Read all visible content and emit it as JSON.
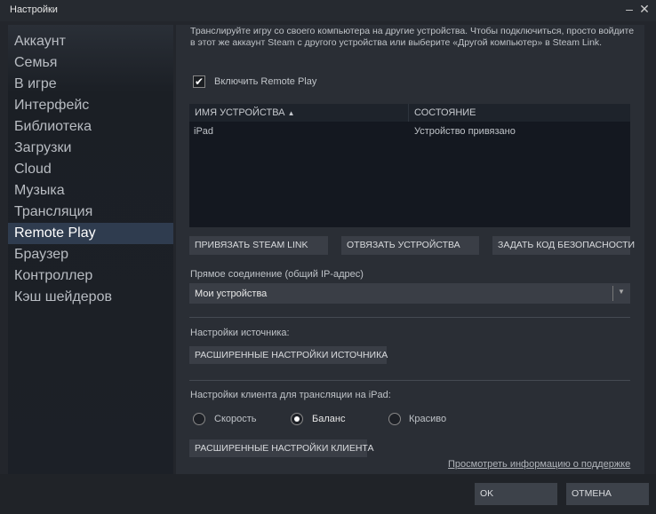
{
  "window": {
    "title": "Настройки"
  },
  "sidebar": {
    "items": [
      {
        "label": "Аккаунт"
      },
      {
        "label": "Семья"
      },
      {
        "label": "В игре"
      },
      {
        "label": "Интерфейс"
      },
      {
        "label": "Библиотека"
      },
      {
        "label": "Загрузки"
      },
      {
        "label": "Cloud"
      },
      {
        "label": "Музыка"
      },
      {
        "label": "Трансляция"
      },
      {
        "label": "Remote Play",
        "selected": true
      },
      {
        "label": "Браузер"
      },
      {
        "label": "Контроллер"
      },
      {
        "label": "Кэш шейдеров"
      }
    ]
  },
  "main": {
    "description": "Транслируйте игру со своего компьютера на другие устройства. Чтобы подключиться, просто войдите в этот же аккаунт Steam с другого устройства или выберите «Другой компьютер» в Steam Link.",
    "enable_label": "Включить Remote Play",
    "enable_checked": true,
    "table": {
      "columns": [
        "ИМЯ УСТРОЙСТВА",
        "СОСТОЯНИЕ"
      ],
      "rows": [
        [
          "iPad",
          "Устройство привязано"
        ]
      ]
    },
    "buttons": {
      "pair": "ПРИВЯЗАТЬ STEAM LINK",
      "unpair": "ОТВЯЗАТЬ УСТРОЙСТВА",
      "security": "ЗАДАТЬ КОД БЕЗОПАСНОСТИ"
    },
    "direct_label": "Прямое соединение (общий IP-адрес)",
    "direct_value": "Мои устройства",
    "host_label": "Настройки источника:",
    "host_button": "РАСШИРЕННЫЕ НАСТРОЙКИ ИСТОЧНИКА",
    "client_label": "Настройки клиента для трансляции на iPad:",
    "quality": [
      {
        "label": "Скорость"
      },
      {
        "label": "Баланс",
        "selected": true
      },
      {
        "label": "Красиво"
      }
    ],
    "client_button": "РАСШИРЕННЫЕ НАСТРОЙКИ КЛИЕНТА",
    "support_link": "Просмотреть информацию о поддержке"
  },
  "footer": {
    "ok": "OK",
    "cancel": "ОТМЕНА"
  }
}
